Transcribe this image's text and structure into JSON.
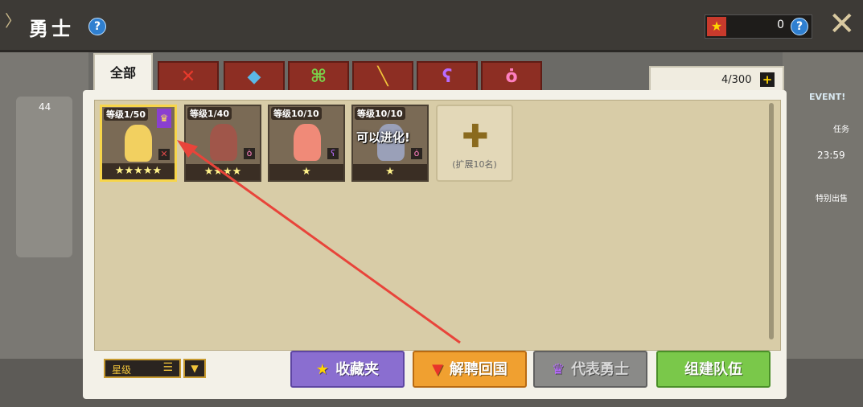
{
  "window": {
    "title": "勇士",
    "help_icon": "?"
  },
  "currency": {
    "value": "0",
    "help_icon": "?"
  },
  "tabs": [
    {
      "label": "全部"
    },
    {
      "icon": "sword-icon",
      "glyph": "✕",
      "color": "#e83a2c"
    },
    {
      "icon": "axe-icon",
      "glyph": "◆",
      "color": "#5bb8e8"
    },
    {
      "icon": "bow-icon",
      "glyph": "⌘",
      "color": "#7ad04a"
    },
    {
      "icon": "staff-icon",
      "glyph": "╲",
      "color": "#f2c53a"
    },
    {
      "icon": "wand-icon",
      "glyph": "ʕ",
      "color": "#b86cff"
    },
    {
      "icon": "amulet-icon",
      "glyph": "ȯ",
      "color": "#ff7fc0"
    }
  ],
  "roster_count": "4/300",
  "heroes": [
    {
      "level": "等级1/50",
      "stars": "★★★★★",
      "selected": true,
      "representative": true,
      "class_glyph": "✕",
      "class_color": "#e04a4a"
    },
    {
      "level": "等级1/40",
      "stars": "★★★★",
      "selected": false,
      "class_glyph": "ȯ",
      "class_color": "#ff7fc0"
    },
    {
      "level": "等级10/10",
      "stars": "★",
      "selected": false,
      "class_glyph": "ʕ",
      "class_color": "#b86cff"
    },
    {
      "level": "等级10/10",
      "stars": "★",
      "selected": false,
      "evolve_text": "可以进化!",
      "class_glyph": "ȯ",
      "class_color": "#ff7fc0"
    }
  ],
  "expand_slot": {
    "label": "(扩展10名)"
  },
  "sort": {
    "label": "星级"
  },
  "buttons": {
    "favorites": "收藏夹",
    "dismiss": "解聘回国",
    "representative": "代表勇士",
    "team": "组建队伍"
  },
  "background": {
    "badge_44": "44",
    "event": "EVENT!",
    "timer": "23:59",
    "special_sale": "特别出售",
    "task": "任务"
  }
}
